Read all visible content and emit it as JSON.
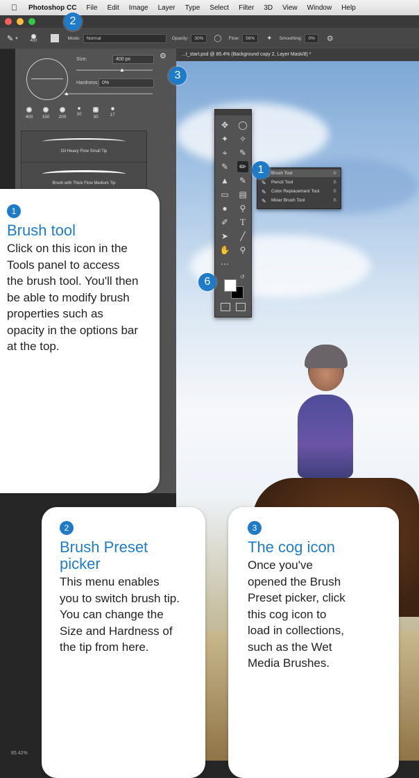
{
  "menubar": {
    "app": "Photoshop CC",
    "items": [
      "File",
      "Edit",
      "Image",
      "Layer",
      "Type",
      "Select",
      "Filter",
      "3D",
      "View",
      "Window",
      "Help"
    ]
  },
  "options_bar": {
    "brush_size": "400",
    "mode_label": "Mode:",
    "mode_value": "Normal",
    "opacity_label": "Opacity:",
    "opacity_value": "30%",
    "flow_label": "Flow:",
    "flow_value": "56%",
    "smoothing_label": "Smoothing:",
    "smoothing_value": "0%"
  },
  "brush_picker": {
    "size_label": "Size:",
    "size_value": "400 px",
    "hardness_label": "Hardness:",
    "hardness_value": "0%",
    "tip_sizes": [
      "400",
      "150",
      "200",
      "10",
      "30",
      "17"
    ],
    "brushes": [
      "Oil Heavy Flow Small Tip",
      "Brush with Thick Flow Medium Tip"
    ]
  },
  "document_tab": "...t_start.psd @ 85.4% (Background copy 2, Layer Mask/8) *",
  "tool_flyout": {
    "items": [
      {
        "label": "Brush Tool",
        "key": "B"
      },
      {
        "label": "Pencil Tool",
        "key": "B"
      },
      {
        "label": "Color Replacement Tool",
        "key": "B"
      },
      {
        "label": "Mixer Brush Tool",
        "key": "B"
      }
    ]
  },
  "markers": {
    "m1": "1",
    "m2": "2",
    "m3": "3",
    "m6": "6"
  },
  "callouts": {
    "brush_tool": {
      "number": "1",
      "title": "Brush tool",
      "body": "Click on this icon in the Tools panel to access the brush tool. You'll then be able to modify brush properties such as opacity in the options bar at the top."
    },
    "brush_preset": {
      "number": "2",
      "title": "Brush Preset picker",
      "body": "This menu enables you to switch brush tip. You can change the Size and Hardness of the tip from here."
    },
    "cog_icon": {
      "number": "3",
      "title": "The cog icon",
      "body": "Once you've opened the Brush Preset picker, click this cog icon to load in collections, such as the Wet Media Brushes."
    }
  },
  "status": {
    "zoom": "85.42%"
  },
  "colors": {
    "accent": "#1f7bc8"
  }
}
